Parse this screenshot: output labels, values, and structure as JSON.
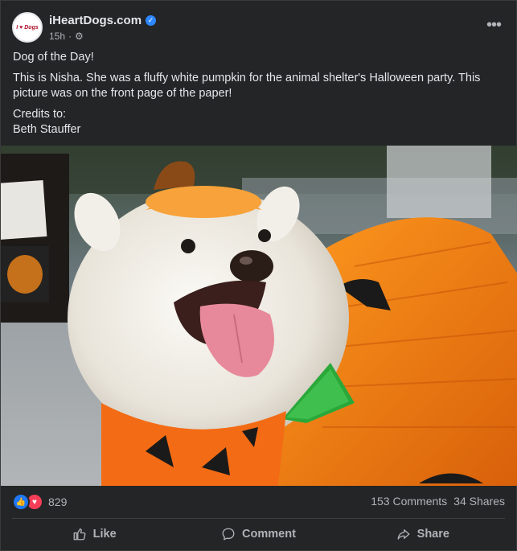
{
  "page": {
    "name": "iHeartDogs.com",
    "logo_text": "I ♥ Dogs",
    "time": "15h",
    "privacy_icon": "gear-icon",
    "verified_icon": "verified-check-icon",
    "more_icon": "more-options-icon"
  },
  "post": {
    "title": "Dog of the Day!",
    "body": "This is Nisha. She was a fluffy white pumpkin for the animal shelter's Halloween party. This picture was on the front page of the paper!",
    "credits_label": "Credits to:",
    "credits_name": "Beth Stauffer"
  },
  "reactions": {
    "icons": [
      "like-reaction-icon",
      "love-reaction-icon"
    ],
    "count": "829",
    "comments": "153 Comments",
    "shares": "34 Shares"
  },
  "actions": {
    "like": "Like",
    "comment": "Comment",
    "share": "Share"
  },
  "colors": {
    "background": "#242526",
    "text": "#e4e6eb",
    "muted": "#b0b3b8",
    "like_blue": "#2078f4",
    "love_red": "#f33e58"
  }
}
